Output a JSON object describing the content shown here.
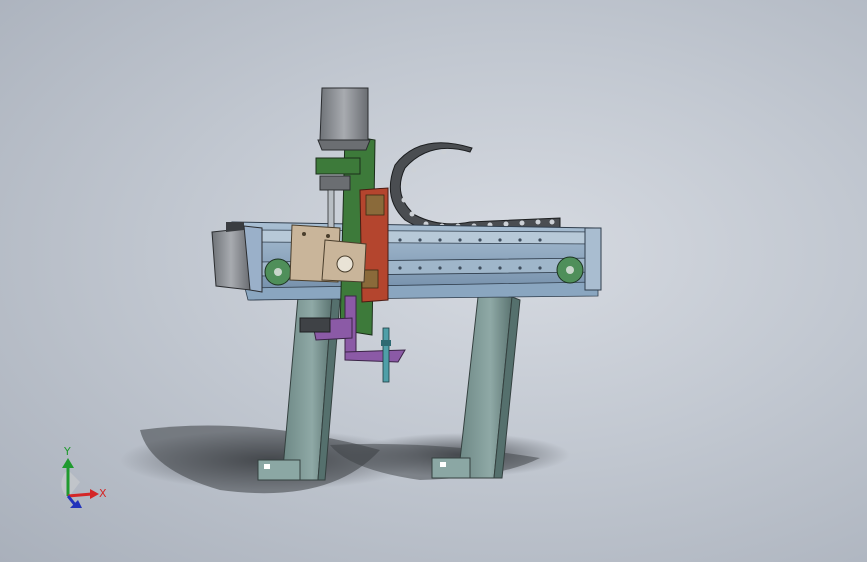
{
  "viewport": {
    "background_top": "#d6dae1",
    "background_bottom": "#a9b0bb"
  },
  "colors": {
    "frame_steel": "#7f9b98",
    "frame_dark": "#4e6664",
    "rail_blue": "#8aa6c0",
    "bracket_tan": "#c9b59a",
    "carriage_green": "#3d7a3a",
    "carriage_red": "#b4452e",
    "bracket_purple": "#8b5aa6",
    "motor_gray": "#8c8f94",
    "chain_dark": "#3a3d40",
    "pulley_green": "#4f8f5a",
    "shadow": "#3c3f44"
  },
  "model": {
    "description_icon": "gantry-robot-cad-model",
    "parts": [
      "vertical-stepper-motor",
      "horizontal-servo-motor",
      "linear-rail",
      "cable-drag-chain",
      "z-axis-carriage",
      "support-leg-left",
      "support-leg-right",
      "tool-holder-bracket"
    ]
  },
  "triad": {
    "x_label": "X",
    "y_label": "Y",
    "x_color": "#d42626",
    "y_color": "#1f9a2e",
    "z_color": "#2233bb"
  }
}
